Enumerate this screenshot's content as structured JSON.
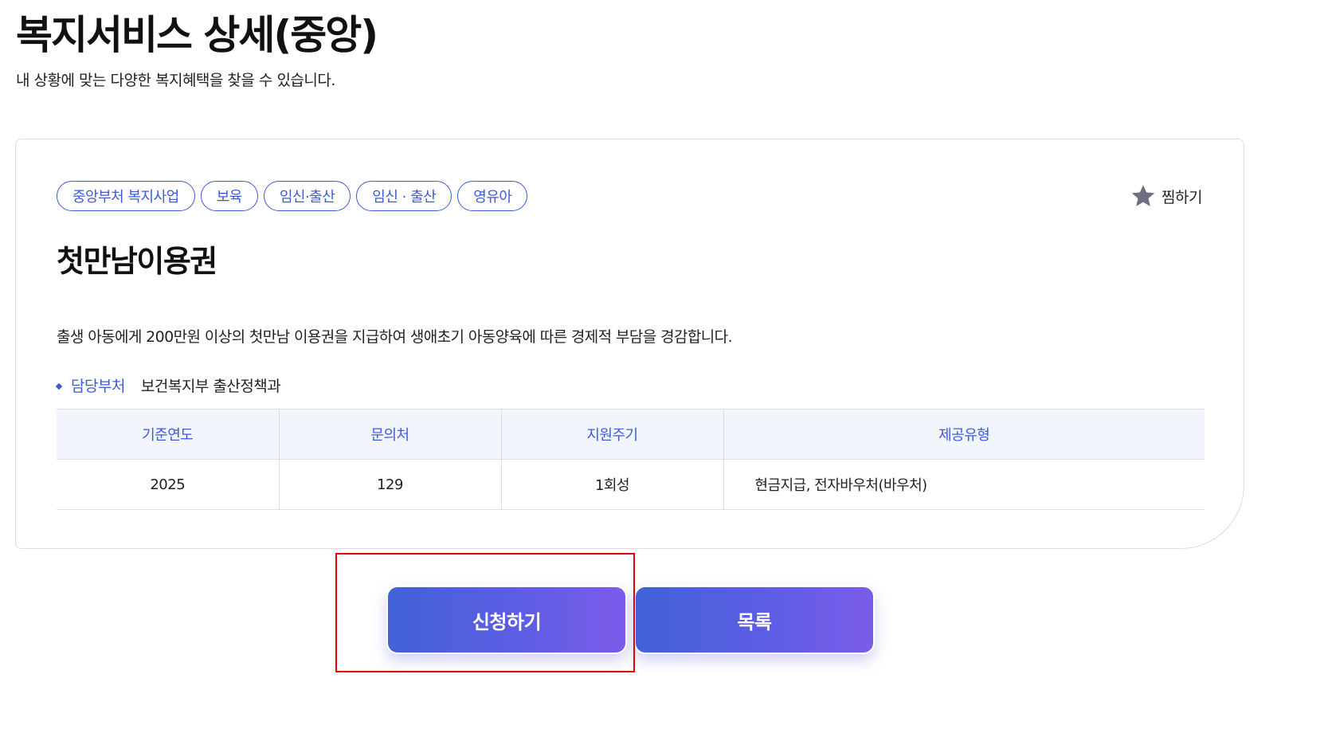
{
  "header": {
    "title": "복지서비스 상세(중앙)",
    "subtitle": "내 상황에 맞는 다양한 복지혜택을 찾을 수 있습니다."
  },
  "service": {
    "tags": [
      "중앙부처 복지사업",
      "보육",
      "임신·출산",
      "임신 · 출산",
      "영유아"
    ],
    "bookmark_label": "찜하기",
    "title": "첫만남이용권",
    "description": "출생 아동에게 200만원 이상의 첫만남 이용권을 지급하여 생애초기 아동양육에 따른 경제적 부담을 경감합니다.",
    "department_label": "담당부처",
    "department_value": "보건복지부 출산정책과"
  },
  "table": {
    "headers": [
      "기준연도",
      "문의처",
      "지원주기",
      "제공유형"
    ],
    "row": [
      "2025",
      "129",
      "1회성",
      "현금지급, 전자바우처(바우처)"
    ]
  },
  "actions": {
    "apply_label": "신청하기",
    "list_label": "목록"
  },
  "colors": {
    "accent": "#3b5bdb",
    "button_gradient_start": "#4162d8",
    "button_gradient_end": "#7a5cea",
    "highlight": "#e60000",
    "star": "#6b6f80"
  }
}
